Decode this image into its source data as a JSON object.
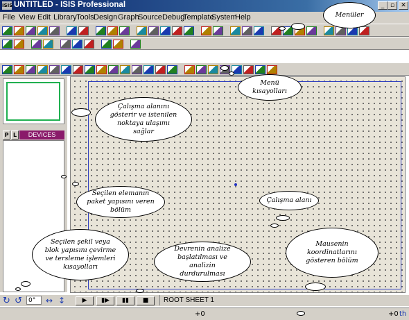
{
  "window": {
    "app_icon_text": "ISIS",
    "title": "UNTITLED - ISIS Professional",
    "controls": [
      "_",
      "▫",
      "✕"
    ]
  },
  "menu": {
    "items": [
      "File",
      "View",
      "Edit",
      "Library",
      "Tools",
      "Design",
      "Graph",
      "Source",
      "Debug",
      "Template",
      "System",
      "Help"
    ]
  },
  "toolbars": {
    "row1_icons": [
      "new-icon",
      "open-icon",
      "save-icon",
      "import-icon",
      "export-icon",
      "print-icon",
      "print-area-icon",
      "refresh-icon",
      "grid-icon",
      "origin-icon",
      "pan-icon",
      "zoom-in-icon",
      "zoom-out-icon",
      "zoom-all-icon",
      "zoom-area-icon",
      "undo-icon",
      "redo-icon",
      "cut-icon",
      "copy-icon",
      "paste-icon",
      "block-copy-icon",
      "block-move-icon",
      "block-rotate-icon",
      "block-delete-icon",
      "pick-device-icon",
      "make-device-icon",
      "packaging-icon",
      "decompose-icon"
    ],
    "row2_icons": [
      "wire-autorouter-icon",
      "search-icon",
      "property-tool-icon",
      "new-sheet-icon",
      "remove-sheet-icon",
      "exit-to-parent-icon",
      "zoom-child-icon",
      "bill-of-materials-icon",
      "electrical-rule-check-icon",
      "netlist-to-ares-icon"
    ],
    "row3_icons": [
      "selection-icon",
      "component-icon",
      "junction-icon",
      "wire-label-icon",
      "text-script-icon",
      "bus-icon",
      "subcircuit-icon",
      "terminal-icon",
      "device-pin-icon",
      "graph-icon",
      "tape-recorder-icon",
      "generator-icon",
      "voltage-probe-icon",
      "current-probe-icon",
      "virtual-instrument-icon",
      "line-icon",
      "box-icon",
      "circle-icon",
      "arc-icon",
      "path-icon",
      "text-icon",
      "symbol-icon",
      "marker-icon"
    ]
  },
  "left_panel": {
    "tab_p": "P",
    "tab_l": "L",
    "devices_header": "DEVICES"
  },
  "bottom_bar": {
    "rotation_value": "0°",
    "sim_buttons": [
      "▶",
      "▮▶",
      "▮▮",
      "■"
    ],
    "sheet_label": "ROOT SHEET 1"
  },
  "status_bar": {
    "x_coord": "+0",
    "y_coord": "+0",
    "unit": "th"
  },
  "annotations": {
    "menus": "Menüler",
    "menu_shortcuts": "Menü kısayolları",
    "overview": "Çalışma alanını gösterir ve istenilen noktaya ulaşımı sağlar",
    "device_packaging": "Seçilen elemanın paket yapısını veren bölüm",
    "work_area": "Çalışma alanı",
    "rotation_shortcuts": "Seçilen şekil veya blok yapısını çevirme ve tersleme işlemleri kısayolları",
    "simulation": "Devrenin analize başlatılması ve analizin durdurulması",
    "coordinates": "Mausenin koordinatlarını gösteren bölüm"
  },
  "colors": {
    "title_bar": "#0a246a",
    "devices_header": "#8a1a6a",
    "sheet_border": "#3040c0",
    "overview_border": "#20b050"
  }
}
